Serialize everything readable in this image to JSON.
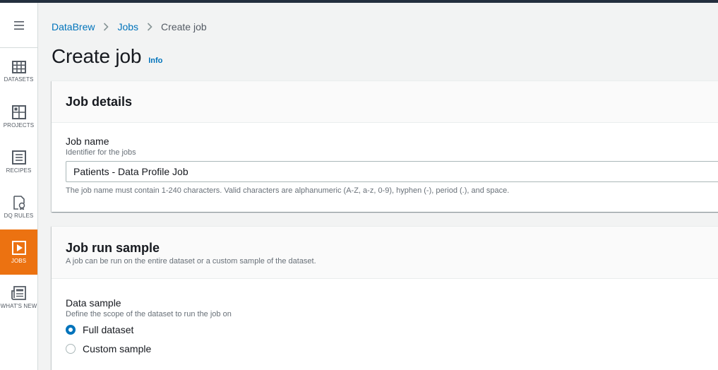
{
  "nav": {
    "items": [
      {
        "label": "DATASETS",
        "icon": "grid-icon"
      },
      {
        "label": "PROJECTS",
        "icon": "projects-icon"
      },
      {
        "label": "RECIPES",
        "icon": "recipe-icon"
      },
      {
        "label": "DQ RULES",
        "icon": "dq-rules-icon"
      },
      {
        "label": "JOBS",
        "icon": "play-icon",
        "active": true
      },
      {
        "label": "WHAT'S NEW",
        "icon": "news-icon"
      }
    ],
    "accent": "#ec7211"
  },
  "breadcrumb": {
    "items": [
      {
        "label": "DataBrew"
      },
      {
        "label": "Jobs"
      },
      {
        "label": "Create job"
      }
    ]
  },
  "page": {
    "title": "Create job",
    "info": "Info"
  },
  "job_details": {
    "title": "Job details",
    "job_name_label": "Job name",
    "job_name_desc": "Identifier for the jobs",
    "job_name_value": "Patients - Data Profile Job",
    "job_name_constraint": "The job name must contain 1-240 characters. Valid characters are alphanumeric (A-Z, a-z, 0-9), hyphen (-), period (.), and space."
  },
  "job_run_sample": {
    "title": "Job run sample",
    "desc": "A job can be run on the entire dataset or a custom sample of the dataset.",
    "data_sample_label": "Data sample",
    "data_sample_desc": "Define the scope of the dataset to run the job on",
    "options": [
      {
        "label": "Full dataset",
        "selected": true
      },
      {
        "label": "Custom sample",
        "selected": false
      }
    ]
  },
  "colors": {
    "link": "#0073bb",
    "topbar": "#232f3e"
  }
}
